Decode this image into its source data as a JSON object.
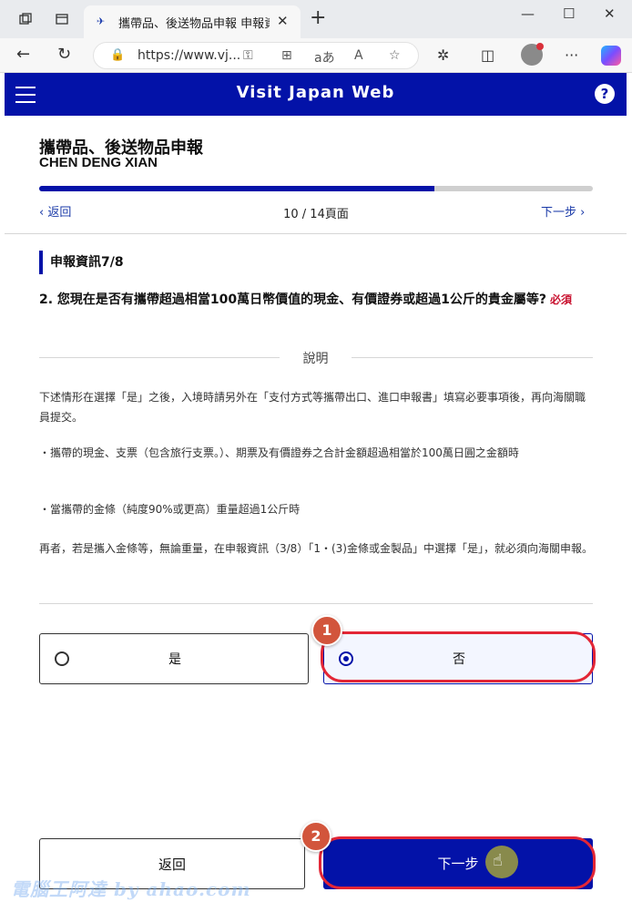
{
  "browser": {
    "tab_title": "攜帶品、後送物品申報 申報資訊",
    "tab_favicon": "✈",
    "new_tab": "+",
    "url": "https://www.vj...",
    "win_min": "—",
    "win_max": "☐",
    "win_close": "✕",
    "icons": [
      "tab-actions-icon",
      "tab-workspace-icon",
      "back-icon",
      "refresh-icon",
      "lock-icon",
      "key-icon",
      "apps-icon",
      "read-aloud-icon",
      "immersive-reader-icon",
      "favorite-star-icon",
      "extensions-icon",
      "split-screen-icon",
      "profile-avatar",
      "more-icon",
      "copilot-icon"
    ]
  },
  "header": {
    "title": "Visit Japan Web",
    "help": "?"
  },
  "page": {
    "title": "攜帶品、後送物品申報",
    "name": "CHEN DENG XIAN",
    "progress_fraction": 0.714,
    "prev": "返回",
    "page_count": "10 / 14頁面",
    "next": "下一步"
  },
  "section": {
    "label": "申報資訊7/8",
    "question": "2. 您現在是否有攜帶超過相當100萬日幣價值的現金、有價證券或超過1公斤的貴金屬等?",
    "required": "必須",
    "explain_title": "說明",
    "paragraphs": [
      "下述情形在選擇「是」之後，入境時請另外在「支付方式等攜帶出口、進口申報書」填寫必要事項後，再向海關職員提交。",
      "・攜帶的現金、支票（包含旅行支票。）、期票及有價證券之合計金額超過相當於100萬日圓之金額時",
      "・當攜帶的金條（純度90%或更高）重量超過1公斤時",
      "再者，若是攜入金條等，無論重量，在申報資訊（3/8）「1・(3)金條或金製品」中選擇「是」，就必須向海關申報。"
    ]
  },
  "choices": {
    "yes": "是",
    "no": "否",
    "selected": "no"
  },
  "annotations": {
    "badge1": "1",
    "badge2": "2"
  },
  "buttons": {
    "back": "返回",
    "next": "下一步"
  },
  "watermark": "電腦王阿達 by ahao.com",
  "colors": {
    "brand": "#0312a8",
    "highlight": "#e32636",
    "badge": "#d2553c",
    "required": "#c8102e"
  }
}
